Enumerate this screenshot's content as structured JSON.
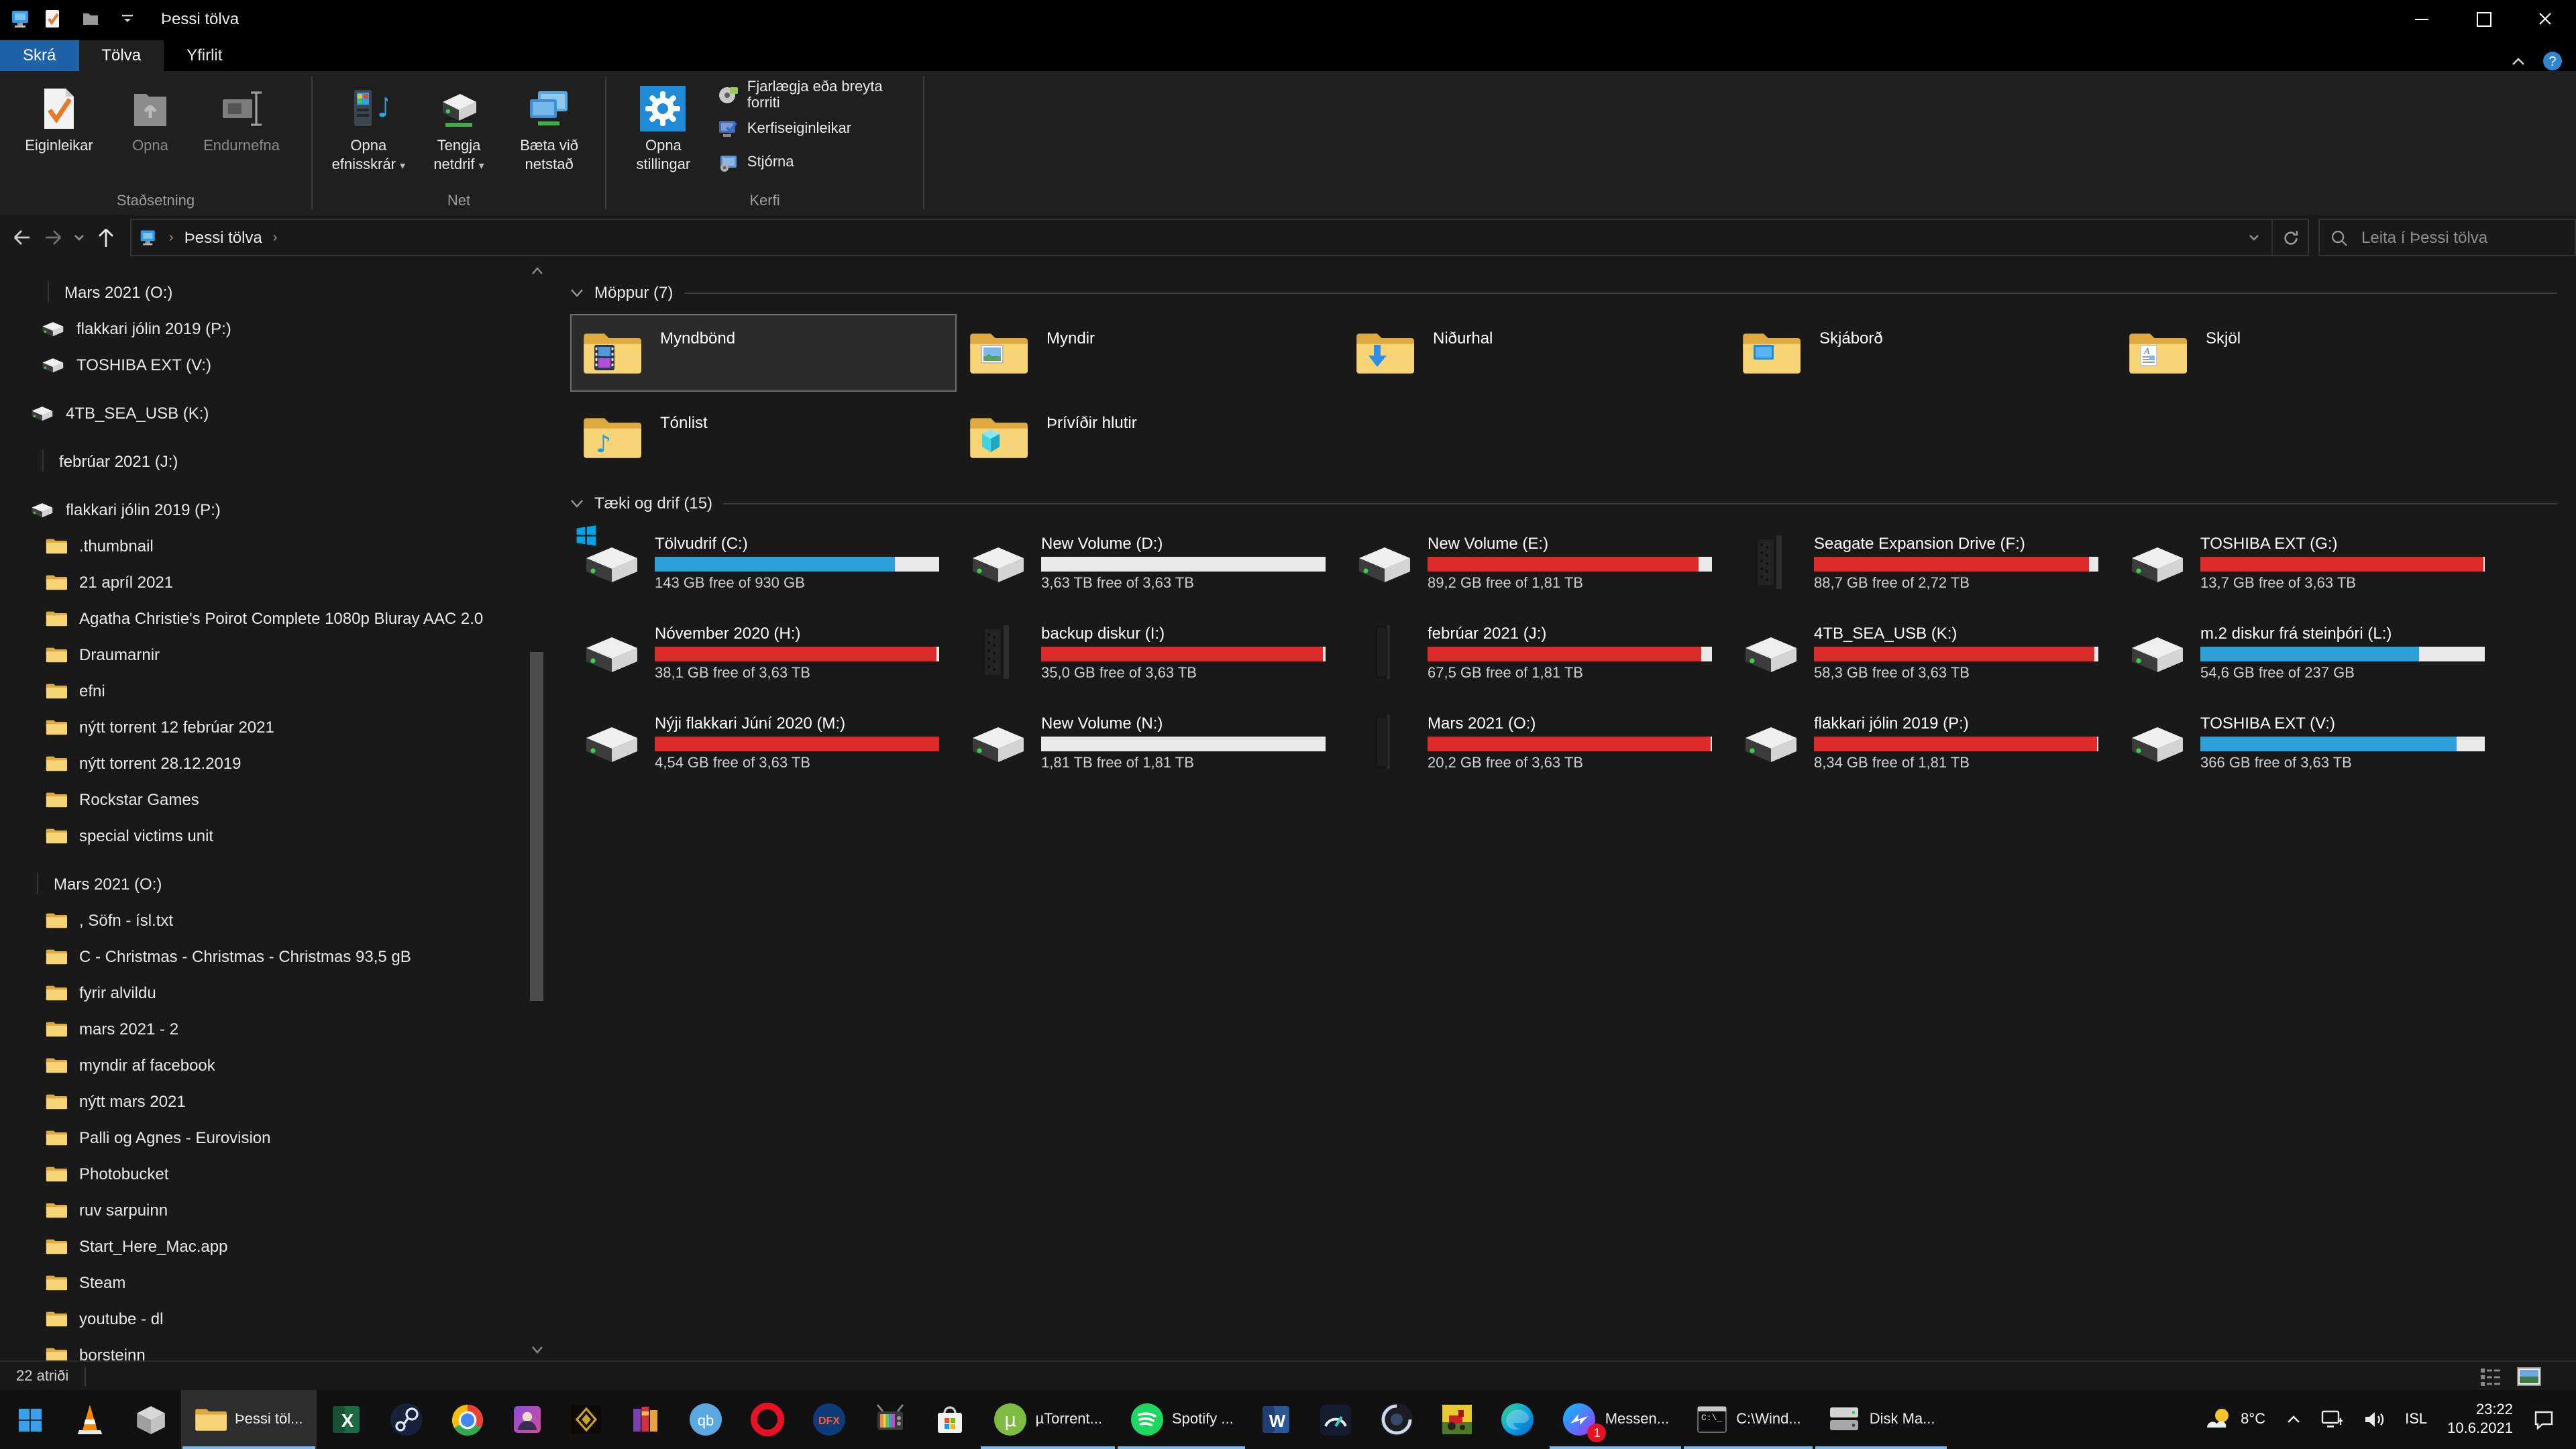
{
  "window": {
    "title": "Þessi tölva"
  },
  "colors": {
    "bar_blue": "#2da0da",
    "bar_red": "#dd2c2c",
    "bar_track": "#e8e8e8",
    "file_tab_blue": "#1e62a8",
    "taskbar_underline": "#76b9ed"
  },
  "ribbon": {
    "tabs": [
      {
        "label": "Skrá"
      },
      {
        "label": "Tölva"
      },
      {
        "label": "Yfirlit"
      }
    ],
    "groups": [
      {
        "label": "Staðsetning",
        "buttons": [
          {
            "label": "Eiginleikar"
          },
          {
            "label": "Opna"
          },
          {
            "label": "Endurnefna"
          }
        ]
      },
      {
        "label": "Net",
        "buttons": [
          {
            "label": "Opna efnisskrár"
          },
          {
            "label": "Tengja netdrif"
          },
          {
            "label": "Bæta við netstað"
          }
        ]
      },
      {
        "label": "Kerfi",
        "big": {
          "label": "Opna stillingar"
        },
        "rows": [
          {
            "label": "Fjarlægja eða breyta forriti"
          },
          {
            "label": "Kerfiseiginleikar"
          },
          {
            "label": "Stjórna"
          }
        ]
      }
    ]
  },
  "address": {
    "breadcrumb": "Þessi tölva",
    "search_placeholder": "Leita í Þessi tölva"
  },
  "sidebar": {
    "items": [
      {
        "label": "Mars 2021 (O:)",
        "icon": "drive-slim",
        "indent": 30
      },
      {
        "label": "flakkari jólin 2019 (P:)",
        "icon": "drive-white",
        "indent": 30
      },
      {
        "label": "TOSHIBA EXT (V:)",
        "icon": "drive-white",
        "indent": 30
      },
      {
        "label": "4TB_SEA_USB (K:)",
        "icon": "drive-white",
        "indent": 22,
        "gap": true
      },
      {
        "label": "febrúar 2021 (J:)",
        "icon": "drive-slim",
        "indent": 26,
        "gap": true
      },
      {
        "label": "flakkari jólin 2019 (P:)",
        "icon": "drive-white",
        "indent": 22,
        "gap": true
      },
      {
        "label": ".thumbnail",
        "icon": "folder",
        "indent": 34
      },
      {
        "label": "21 apríl 2021",
        "icon": "folder",
        "indent": 34
      },
      {
        "label": "Agatha Christie's Poirot Complete 1080p Bluray AAC 2.0",
        "icon": "folder",
        "indent": 34
      },
      {
        "label": "Draumarnir",
        "icon": "folder",
        "indent": 34
      },
      {
        "label": "efni",
        "icon": "folder",
        "indent": 34
      },
      {
        "label": "nýtt torrent 12 febrúar 2021",
        "icon": "folder",
        "indent": 34
      },
      {
        "label": "nýtt torrent 28.12.2019",
        "icon": "folder",
        "indent": 34
      },
      {
        "label": "Rockstar Games",
        "icon": "folder",
        "indent": 34
      },
      {
        "label": "special victims unit",
        "icon": "folder",
        "indent": 34
      },
      {
        "label": "Mars 2021 (O:)",
        "icon": "drive-slim",
        "indent": 22,
        "gap": true
      },
      {
        "label": ", Söfn - ísl.txt",
        "icon": "folder",
        "indent": 34
      },
      {
        "label": "C - Christmas - Christmas - Christmas 93,5 gB",
        "icon": "folder",
        "indent": 34
      },
      {
        "label": "fyrir alvildu",
        "icon": "folder",
        "indent": 34
      },
      {
        "label": "mars 2021 - 2",
        "icon": "folder",
        "indent": 34
      },
      {
        "label": "myndir af facebook",
        "icon": "folder",
        "indent": 34
      },
      {
        "label": "nýtt mars 2021",
        "icon": "folder",
        "indent": 34
      },
      {
        "label": "Palli og Agnes - Eurovision",
        "icon": "folder",
        "indent": 34
      },
      {
        "label": "Photobucket",
        "icon": "folder",
        "indent": 34
      },
      {
        "label": "ruv sarpuinn",
        "icon": "folder",
        "indent": 34
      },
      {
        "label": "Start_Here_Mac.app",
        "icon": "folder",
        "indent": 34
      },
      {
        "label": "Steam",
        "icon": "folder",
        "indent": 34
      },
      {
        "label": "youtube - dl",
        "icon": "folder",
        "indent": 34
      },
      {
        "label": "þorsteinn",
        "icon": "folder",
        "indent": 34
      }
    ]
  },
  "main": {
    "folders_header": "Möppur (7)",
    "folders": [
      {
        "name": "Myndbönd",
        "overlay": "video",
        "selected": true
      },
      {
        "name": "Myndir",
        "overlay": "pictures"
      },
      {
        "name": "Niðurhal",
        "overlay": "download"
      },
      {
        "name": "Skjáborð",
        "overlay": "desktop"
      },
      {
        "name": "Skjöl",
        "overlay": "documents"
      },
      {
        "name": "Tónlist",
        "overlay": "music"
      },
      {
        "name": "Þrívíðir hlutir",
        "overlay": "threed"
      }
    ],
    "drives_header": "Tæki og drif (15)",
    "drives": [
      {
        "name": "Tölvudrif (C:)",
        "free": "143 GB free of 930 GB",
        "used_pct": 84.6,
        "color": "blue",
        "icon": "windows"
      },
      {
        "name": "New Volume (D:)",
        "free": "3,63 TB free of 3,63 TB",
        "used_pct": 0,
        "color": "blue",
        "icon": "white"
      },
      {
        "name": "New Volume (E:)",
        "free": "89,2 GB free of 1,81 TB",
        "used_pct": 95.2,
        "color": "red",
        "icon": "white"
      },
      {
        "name": "Seagate Expansion Drive (F:)",
        "free": "88,7 GB free of 2,72 TB",
        "used_pct": 96.8,
        "color": "red",
        "icon": "seagate"
      },
      {
        "name": "TOSHIBA EXT (G:)",
        "free": "13,7 GB free of 3,63 TB",
        "used_pct": 99.6,
        "color": "red",
        "icon": "white"
      },
      {
        "name": "Nóvember 2020 (H:)",
        "free": "38,1 GB free of 3,63 TB",
        "used_pct": 99.0,
        "color": "red",
        "icon": "white"
      },
      {
        "name": "backup diskur (I:)",
        "free": "35,0 GB free of 3,63 TB",
        "used_pct": 99.1,
        "color": "red",
        "icon": "seagate"
      },
      {
        "name": "febrúar 2021 (J:)",
        "free": "67,5 GB free of 1,81 TB",
        "used_pct": 96.4,
        "color": "red",
        "icon": "slim"
      },
      {
        "name": "4TB_SEA_USB (K:)",
        "free": "58,3 GB free of 3,63 TB",
        "used_pct": 98.4,
        "color": "red",
        "icon": "white"
      },
      {
        "name": "m.2 diskur frá steinþóri (L:)",
        "free": "54,6 GB free of 237 GB",
        "used_pct": 77.0,
        "color": "blue",
        "icon": "white"
      },
      {
        "name": "Nýji flakkari Júní 2020 (M:)",
        "free": "4,54 GB free of 3,63 TB",
        "used_pct": 99.9,
        "color": "red",
        "icon": "white"
      },
      {
        "name": "New Volume (N:)",
        "free": "1,81 TB free of 1,81 TB",
        "used_pct": 0,
        "color": "blue",
        "icon": "white"
      },
      {
        "name": "Mars 2021 (O:)",
        "free": "20,2 GB free of 3,63 TB",
        "used_pct": 99.5,
        "color": "red",
        "icon": "slim"
      },
      {
        "name": "flakkari jólin 2019 (P:)",
        "free": "8,34 GB free of 1,81 TB",
        "used_pct": 99.5,
        "color": "red",
        "icon": "white"
      },
      {
        "name": "TOSHIBA EXT (V:)",
        "free": "366 GB free of 3,63 TB",
        "used_pct": 90.2,
        "color": "blue",
        "icon": "white"
      }
    ]
  },
  "statusbar": {
    "count": "22 atriði"
  },
  "taskbar": {
    "apps": [
      {
        "name": "vlc"
      },
      {
        "name": "gray-box"
      },
      {
        "name": "explorer",
        "label": "Þessi töl...",
        "open": true,
        "active": true
      },
      {
        "name": "excel"
      },
      {
        "name": "steam"
      },
      {
        "name": "chrome"
      },
      {
        "name": "photos"
      },
      {
        "name": "game"
      },
      {
        "name": "winrar"
      },
      {
        "name": "qbittorrent"
      },
      {
        "name": "opera"
      },
      {
        "name": "dfx"
      },
      {
        "name": "tv"
      },
      {
        "name": "store"
      },
      {
        "name": "utorrent",
        "label": "µTorrent...",
        "open": true
      },
      {
        "name": "spotify",
        "label": "Spotify ...",
        "open": true
      },
      {
        "name": "word"
      },
      {
        "name": "speedtest"
      },
      {
        "name": "cinema4d"
      },
      {
        "name": "farming"
      },
      {
        "name": "edge"
      },
      {
        "name": "messenger",
        "label": "Messen...",
        "open": true,
        "badge": "1"
      },
      {
        "name": "cmd",
        "label": "C:\\Wind...",
        "open": true
      },
      {
        "name": "diskmgmt",
        "label": "Disk Ma...",
        "open": true
      }
    ],
    "tray": {
      "weather": "8°C",
      "lang": "ISL",
      "time": "23:22",
      "date": "10.6.2021"
    }
  }
}
